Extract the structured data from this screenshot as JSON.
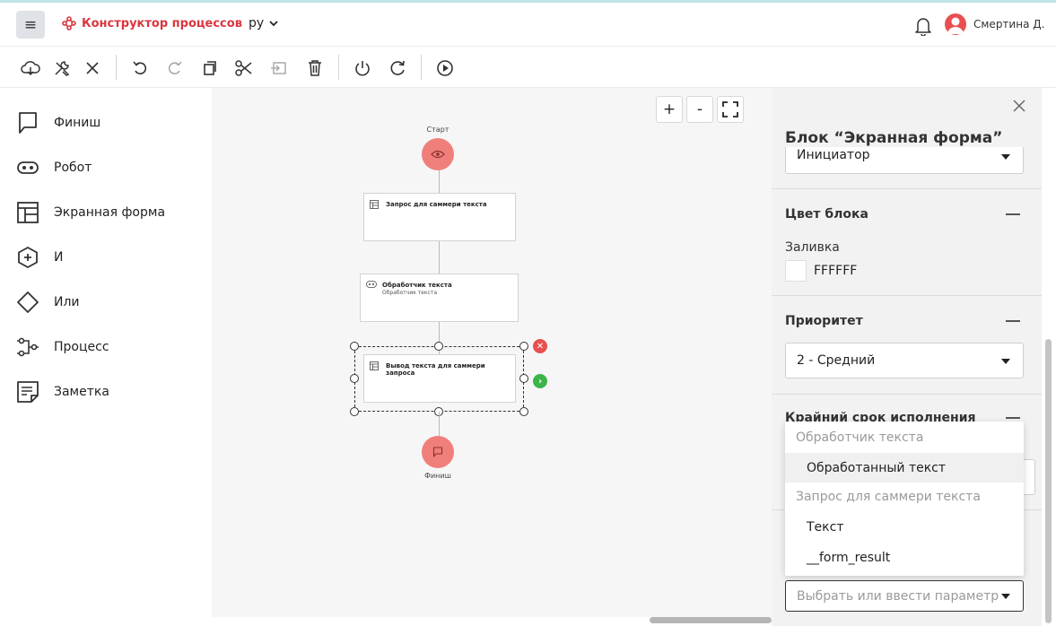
{
  "header": {
    "app_title": "Конструктор процессов",
    "language": "ру",
    "user_name": "Смертина Д."
  },
  "colors": {
    "brand": "#d9363e",
    "node": "#f07f7c",
    "delete_bubble": "#e8504f",
    "next_bubble": "#3bb54a"
  },
  "toolbar": {
    "icons": [
      "cloud-save-icon",
      "tools-icon",
      "close-icon",
      "undo-icon",
      "redo-icon",
      "copy-icon",
      "cut-icon",
      "paste-icon",
      "delete-icon",
      "power-icon",
      "refresh-icon",
      "play-icon"
    ]
  },
  "palette": {
    "items": [
      {
        "label": "Финиш",
        "icon": "flag-icon"
      },
      {
        "label": "Робот",
        "icon": "robot-icon"
      },
      {
        "label": "Экранная форма",
        "icon": "screen-form-icon"
      },
      {
        "label": "И",
        "icon": "and-gateway-icon"
      },
      {
        "label": "Или",
        "icon": "or-gateway-icon"
      },
      {
        "label": "Процесс",
        "icon": "process-icon"
      },
      {
        "label": "Заметка",
        "icon": "note-icon"
      }
    ]
  },
  "canvas": {
    "zoom_in": "+",
    "zoom_out": "-",
    "start_label": "Старт",
    "finish_label": "Финиш",
    "blocks": [
      {
        "title": "Запрос для саммери текста",
        "subtitle": ""
      },
      {
        "title": "Обработчик текста",
        "subtitle": "Обработчик текста"
      },
      {
        "title": "Вывод текста для саммери запроса",
        "subtitle": ""
      }
    ]
  },
  "panel": {
    "title": "Блок “Экранная форма”",
    "executor_value": "Инициатор",
    "color_section": "Цвет блока",
    "fill_label": "Заливка",
    "fill_value": "FFFFFF",
    "priority_section": "Приоритет",
    "priority_value": "2 - Средний",
    "deadline_section": "Крайний срок исполнения",
    "param_placeholder": "Выбрать или ввести параметр"
  },
  "dropdown": {
    "groups": [
      {
        "label": "Обработчик текста",
        "options": [
          "Обработанный текст"
        ]
      },
      {
        "label": "Запрос для саммери текста",
        "options": [
          "Текст",
          "__form_result"
        ]
      }
    ]
  }
}
